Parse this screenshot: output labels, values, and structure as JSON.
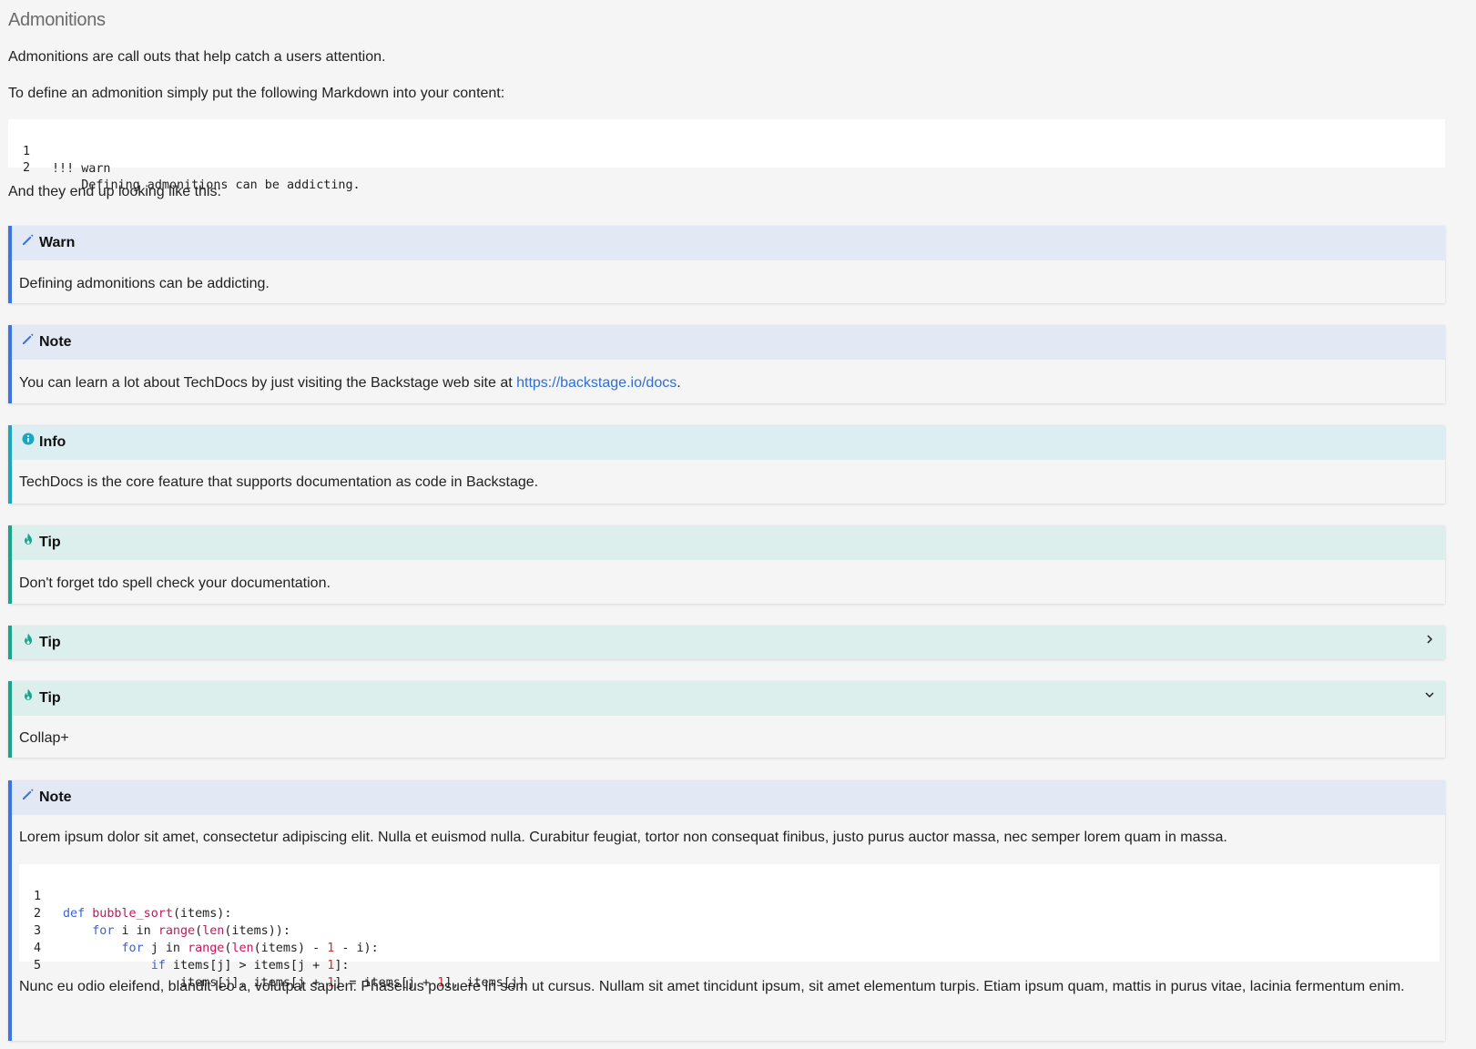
{
  "page": {
    "title": "Admonitions",
    "intro": "Admonitions are call outs that help catch a users attention.",
    "define_text": "To define an admonition simply put the following Markdown into your content:",
    "result_text": "And they end up looking like this:"
  },
  "markdown_example": {
    "lines": [
      {
        "num": "1",
        "text": "!!! warn"
      },
      {
        "num": "2",
        "text": "    Defining admonitions can be addicting."
      }
    ]
  },
  "admonitions": [
    {
      "title": "Warn",
      "icon": "pencil-icon",
      "body": "Defining admonitions can be addicting."
    },
    {
      "title": "Note",
      "icon": "pencil-icon",
      "body_before_link": "You can learn a lot about TechDocs by just visiting the Backstage web site at ",
      "link": "https://backstage.io/docs",
      "body_after_link": "."
    },
    {
      "title": "Info",
      "icon": "info-icon",
      "body": "TechDocs is the core feature that supports documentation as code in Backstage."
    },
    {
      "title": "Tip",
      "icon": "flame-icon",
      "body": "Don't forget tdo spell check your documentation."
    },
    {
      "title": "Tip",
      "icon": "flame-icon",
      "collapsed": true
    },
    {
      "title": "Tip",
      "icon": "flame-icon",
      "expanded": true,
      "body": "Collap+"
    },
    {
      "title": "Note",
      "icon": "pencil-icon",
      "body": "Lorem ipsum dolor sit amet, consectetur adipiscing elit. Nulla et euismod nulla. Curabitur feugiat, tortor non consequat finibus, justo purus auctor massa, nec semper lorem quam in massa.",
      "footer": "Nunc eu odio eleifend, blandit leo a, volutpat sapien. Phasellus posuere in sem ut cursus. Nullam sit amet tincidunt ipsum, sit amet elementum turpis. Etiam ipsum quam, mattis in purus vitae, lacinia fermentum enim.",
      "code": {
        "line_numbers": [
          "1",
          "2",
          "3",
          "4",
          "5"
        ],
        "l1": {
          "kw": "def",
          "fn": "bubble_sort",
          "rest": "(items):"
        },
        "l2": {
          "indent": "    ",
          "kw": "for",
          "a": " i in ",
          "fn1": "range",
          "b": "(",
          "fn2": "len",
          "c": "(items)):"
        },
        "l3": {
          "indent": "        ",
          "kw": "for",
          "a": " j in ",
          "fn1": "range",
          "b": "(",
          "fn2": "len",
          "c": "(items) - ",
          "n1": "1",
          "d": " - i):"
        },
        "l4": {
          "indent": "            ",
          "kw": "if",
          "a": " items[j] > items[j + ",
          "n1": "1",
          "b": "]:"
        },
        "l5": {
          "indent": "                ",
          "a": "items[j], items[j + ",
          "n1": "1",
          "b": "] = items[j + ",
          "n2": "1",
          "c": "], items[j]"
        }
      }
    }
  ],
  "colors": {
    "note_blue": "#3b74e6",
    "info_cyan": "#1aa6bf",
    "tip_teal": "#17a68a",
    "link": "#2f6fd1"
  }
}
